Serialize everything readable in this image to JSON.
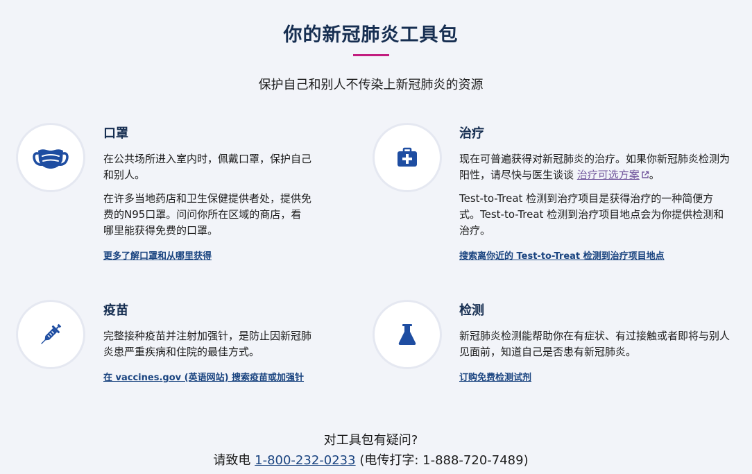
{
  "header": {
    "title": "你的新冠肺炎工具包",
    "subtitle": "保护自己和别人不传染上新冠肺炎的资源"
  },
  "cards": {
    "masks": {
      "icon": "face-mask-icon",
      "title": "口罩",
      "paragraphs": [
        "在公共场所进入室内时，佩戴口罩，保护自己和别人。",
        "在许多当地药店和卫生保健提供者处，提供免费的N95口罩。问问你所在区域的商店，看哪里能获得免费的口罩。"
      ],
      "link": "更多了解口罩和从哪里获得"
    },
    "treatment": {
      "icon": "medical-kit-icon",
      "title": "治疗",
      "paragraph1_prefix": "现在可普遍获得对新冠肺炎的治疗。如果你新冠肺炎检测为阳性，请尽快与医生谈谈 ",
      "paragraph1_link": "治疗可选方案",
      "paragraph1_suffix": "。",
      "paragraph2": "Test-to-Treat 检测到治疗项目是获得治疗的一种简便方式。Test-to-Treat 检测到治疗项目地点会为你提供检测和治疗。",
      "link": "搜索离你近的 Test-to-Treat 检测到治疗项目地点"
    },
    "vaccines": {
      "icon": "syringe-icon",
      "title": "疫苗",
      "paragraphs": [
        "完整接种疫苗并注射加强针，是防止因新冠肺炎患严重疾病和住院的最佳方式。"
      ],
      "link": "在 vaccines.gov (英语网站) 搜索疫苗或加强针"
    },
    "testing": {
      "icon": "flask-icon",
      "title": "检测",
      "paragraphs": [
        "新冠肺炎检测能帮助你在有症状、有过接触或者即将与别人见面前，知道自己是否患有新冠肺炎。"
      ],
      "link": "订购免费检测试剂"
    }
  },
  "footer": {
    "question": "对工具包有疑问?",
    "call_prefix": "请致电 ",
    "phone": "1-800-232-0233",
    "tty": " (电传打字: 1-888-720-7489)"
  },
  "colors": {
    "navy": "#162e51",
    "accent_rule": "#c21d7f",
    "icon_blue": "#1e4da1",
    "link_blue": "#1a4480",
    "visited_purple": "#71569c"
  }
}
